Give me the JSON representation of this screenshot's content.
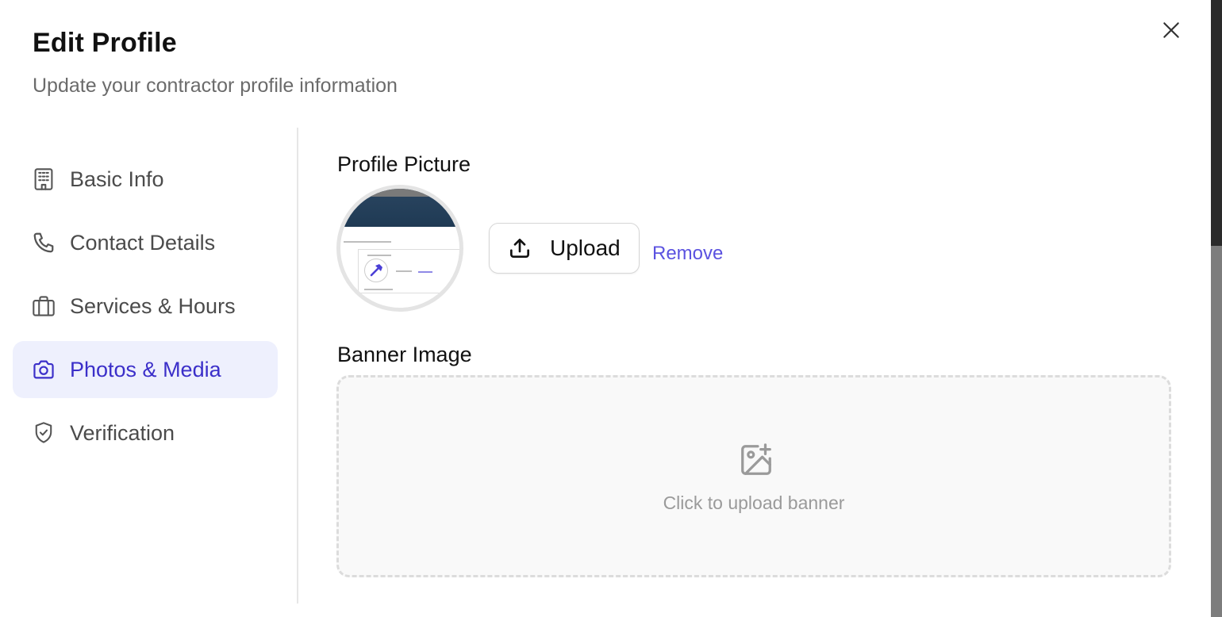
{
  "header": {
    "title": "Edit Profile",
    "subtitle": "Update your contractor profile information"
  },
  "sidebar": {
    "items": [
      {
        "label": "Basic Info",
        "icon": "building-icon",
        "active": false
      },
      {
        "label": "Contact Details",
        "icon": "phone-icon",
        "active": false
      },
      {
        "label": "Services & Hours",
        "icon": "briefcase-icon",
        "active": false
      },
      {
        "label": "Photos & Media",
        "icon": "camera-icon",
        "active": true
      },
      {
        "label": "Verification",
        "icon": "shield-check-icon",
        "active": false
      }
    ]
  },
  "main": {
    "profile_picture": {
      "label": "Profile Picture",
      "upload_label": "Upload",
      "remove_label": "Remove"
    },
    "banner": {
      "label": "Banner Image",
      "hint": "Click to upload banner"
    }
  },
  "colors": {
    "accent": "#3b2fc9",
    "accent_bg": "#eef0fd",
    "link": "#5b52e0"
  }
}
